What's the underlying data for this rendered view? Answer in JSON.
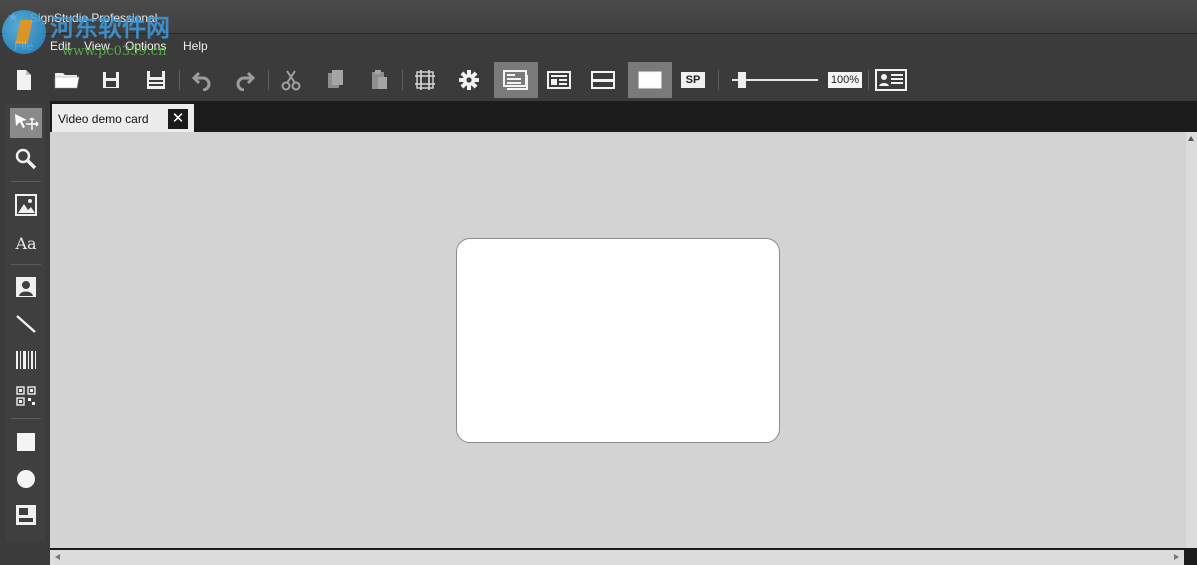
{
  "window": {
    "title": "SignStudio Professional"
  },
  "menu": {
    "items": [
      "File",
      "Edit",
      "View",
      "Options",
      "Help"
    ]
  },
  "toolbar": {
    "zoom_level": "100%",
    "special_print_label": "SP",
    "zoom_slider_value": 0.08,
    "buttons": [
      "new-file",
      "open-folder",
      "save",
      "save-as",
      "undo",
      "redo",
      "cut",
      "copy",
      "paste",
      "grid",
      "settings",
      "front-side",
      "back-side",
      "magstripe",
      "card-view",
      "special-print",
      "zoom-slider",
      "zoom-level",
      "card-print"
    ]
  },
  "document": {
    "tab_label": "Video demo card",
    "close_glyph": "✕"
  },
  "palette": {
    "text_tool_label": "Aa",
    "tools": [
      "select",
      "zoom",
      "image",
      "text",
      "photo",
      "line",
      "barcode",
      "qrcode",
      "rectangle",
      "ellipse",
      "picture-field"
    ]
  },
  "watermark": {
    "text": "河东软件网",
    "url": "www.pc0359.cn"
  }
}
